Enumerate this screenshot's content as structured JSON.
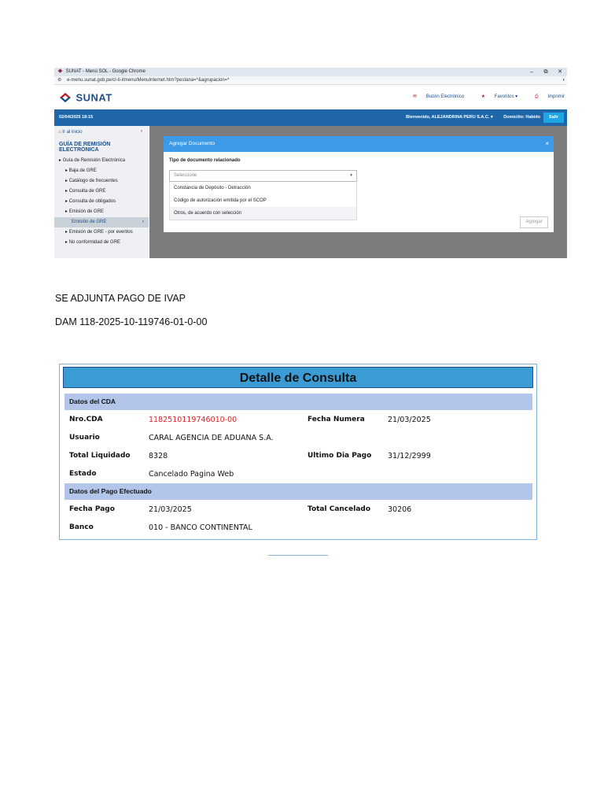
{
  "sunat_screenshot": {
    "browser_title": "SUNAT - Menú SOL - Google Chrome",
    "window_controls": [
      "–",
      "⧉",
      "✕"
    ],
    "url": "e-menu.sunat.gob.pe/cl-ti-itmenu/MenuInternet.htm?pestana=*&agrupacion=*",
    "logo_text": "SUNAT",
    "header_links": {
      "buzon": "Buzón Electrónico",
      "favoritos": "Favoritos",
      "imprimir": "Imprimir"
    },
    "datetime": "02/04/2025 18:15",
    "welcome": "Bienvenido, ALEJANDRINA PERU S.A.C.",
    "domicilio": "Domicilio: Habido",
    "salir": "Salir",
    "sidebar": {
      "home": "Ir al inicio",
      "title": "GUÍA DE REMISIÓN ELECTRÓNICA",
      "items": [
        "Guía de Remisión Electrónica",
        "Baja de GRE",
        "Catálogo de frecuentes",
        "Consulta de GRE",
        "Consulta de obligados",
        "Emisión de GRE",
        "Emisión de GRE",
        "Emisión de GRE - por eventos",
        "No conformidad de GRE"
      ]
    },
    "modal": {
      "title": "Agregar Documento",
      "close": "×",
      "label": "Tipo de documento relacionado",
      "select_placeholder": "Seleccione",
      "options": [
        "Constancia de Depósito - Detracción",
        "Código de autorización emitida por el SCOP",
        "Otros, de acuerdo con selección"
      ],
      "button": "Agregar"
    }
  },
  "notes": {
    "line1": "SE ADJUNTA PAGO DE IVAP",
    "line2": "DAM 118-2025-10-119746-01-0-00"
  },
  "detalle": {
    "title": "Detalle de Consulta",
    "section1": "Datos del CDA",
    "nro_cda_label": "Nro.CDA",
    "nro_cda_value": "1182510119746010-00",
    "fecha_numera_label": "Fecha Numera",
    "fecha_numera_value": "21/03/2025",
    "usuario_label": "Usuario",
    "usuario_value": "CARAL AGENCIA DE ADUANA S.A.",
    "total_liquidado_label": "Total Liquidado",
    "total_liquidado_value": "8328",
    "ultimo_dia_label": "Ultimo Dia Pago",
    "ultimo_dia_value": "31/12/2999",
    "estado_label": "Estado",
    "estado_value": "Cancelado Pagina Web",
    "section2": "Datos del Pago Efectuado",
    "fecha_pago_label": "Fecha Pago",
    "fecha_pago_value": "21/03/2025",
    "total_cancelado_label": "Total Cancelado",
    "total_cancelado_value": "30206",
    "banco_label": "Banco",
    "banco_value": "010 - BANCO CONTINENTAL"
  },
  "colors": {
    "sunat_blue": "#1f67a8",
    "modal_header": "#3c9be9",
    "detalle_header": "#3a9bd5",
    "section_header": "#b3c6ea",
    "cda_red": "#d9232a"
  }
}
